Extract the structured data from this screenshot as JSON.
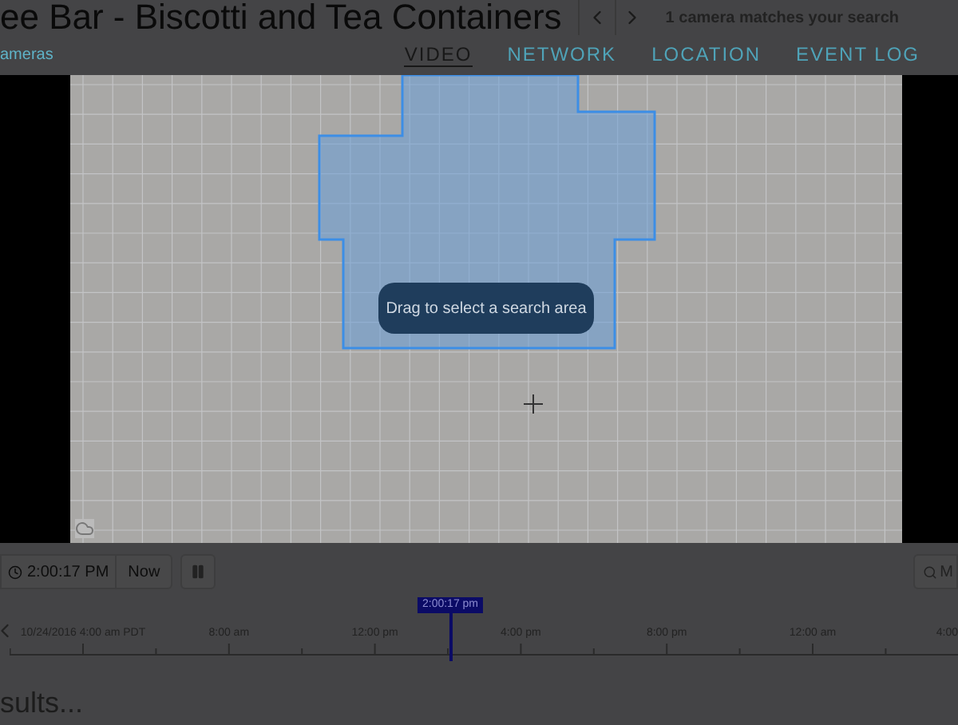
{
  "header": {
    "title": "ee Bar - Biscotti and Tea Containers",
    "match_text": "1 camera matches your search",
    "back_link": "ameras"
  },
  "tabs": [
    {
      "label": "VIDEO",
      "selected": true
    },
    {
      "label": "NETWORK",
      "selected": false
    },
    {
      "label": "LOCATION",
      "selected": false
    },
    {
      "label": "EVENT LOG",
      "selected": false
    }
  ],
  "video": {
    "tooltip": "Drag to select a search area"
  },
  "controls": {
    "time": "2:00:17 PM",
    "now": "Now",
    "search_button": "M"
  },
  "timeline": {
    "ticks": [
      "10/24/2016 4:00 am PDT",
      "8:00 am",
      "12:00 pm",
      "4:00 pm",
      "8:00 pm",
      "12:00 am",
      "4:00"
    ],
    "cursor": {
      "label": "2:00:17 pm",
      "level": 0.47
    }
  },
  "results_text": "sults..."
}
